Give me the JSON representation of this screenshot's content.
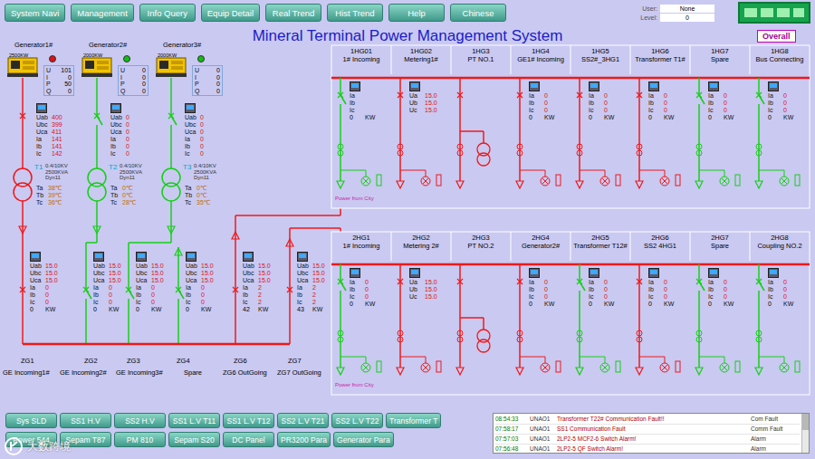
{
  "nav": [
    "System Navi",
    "Management",
    "Info Query",
    "Equip Detail",
    "Real Trend",
    "Hist Trend",
    "Help",
    "Chinese"
  ],
  "user": {
    "user_label": "User:",
    "user": "None",
    "level_label": "Level:",
    "level": "0"
  },
  "title": "Mineral Terminal Power Management System",
  "overall": "Overall",
  "generators": [
    {
      "name": "Generator1#",
      "rating": "2500KW",
      "running": true,
      "status_color": "#e01010",
      "readings": [
        {
          "label": "U",
          "value": "101"
        },
        {
          "label": "I",
          "value": "0"
        },
        {
          "label": "P",
          "value": "50"
        },
        {
          "label": "Q",
          "value": "0"
        }
      ],
      "breaker": {
        "closed": true,
        "readings": [
          {
            "label": "Uab",
            "value": "400"
          },
          {
            "label": "Ubc",
            "value": "399"
          },
          {
            "label": "Uca",
            "value": "411"
          },
          {
            "label": "Ia",
            "value": "141"
          },
          {
            "label": "Ib",
            "value": "141"
          },
          {
            "label": "Ic",
            "value": "142"
          }
        ]
      },
      "transformer": {
        "name": "T1",
        "spec": [
          "0.4/10KV",
          "2500KVA",
          "Dyn11"
        ],
        "temps": [
          {
            "label": "Ta",
            "value": "38℃"
          },
          {
            "label": "Tb",
            "value": "39℃"
          },
          {
            "label": "Tc",
            "value": "36℃"
          }
        ]
      }
    },
    {
      "name": "Generator2#",
      "rating": "2000KW",
      "running": false,
      "status_color": "#10c010",
      "readings": [
        {
          "label": "U",
          "value": "0"
        },
        {
          "label": "I",
          "value": "0"
        },
        {
          "label": "P",
          "value": "0"
        },
        {
          "label": "Q",
          "value": "0"
        }
      ],
      "breaker": {
        "closed": false,
        "readings": [
          {
            "label": "Uab",
            "value": "0"
          },
          {
            "label": "Ubc",
            "value": "0"
          },
          {
            "label": "Uca",
            "value": "0"
          },
          {
            "label": "Ia",
            "value": "0"
          },
          {
            "label": "Ib",
            "value": "0"
          },
          {
            "label": "Ic",
            "value": "0"
          }
        ]
      },
      "transformer": {
        "name": "T2",
        "spec": [
          "0.4/10KV",
          "2500KVA",
          "Dyn11"
        ],
        "temps": [
          {
            "label": "Ta",
            "value": "0℃"
          },
          {
            "label": "Tb",
            "value": "0℃"
          },
          {
            "label": "Tc",
            "value": "28℃"
          }
        ]
      }
    },
    {
      "name": "Generator3#",
      "rating": "2000KW",
      "running": false,
      "status_color": "#10c010",
      "readings": [
        {
          "label": "U",
          "value": "0"
        },
        {
          "label": "I",
          "value": "0"
        },
        {
          "label": "P",
          "value": "0"
        },
        {
          "label": "Q",
          "value": "0"
        }
      ],
      "breaker": {
        "closed": false,
        "readings": [
          {
            "label": "Uab",
            "value": "0"
          },
          {
            "label": "Ubc",
            "value": "0"
          },
          {
            "label": "Uca",
            "value": "0"
          },
          {
            "label": "Ia",
            "value": "0"
          },
          {
            "label": "Ib",
            "value": "0"
          },
          {
            "label": "Ic",
            "value": "0"
          }
        ]
      },
      "transformer": {
        "name": "T3",
        "spec": [
          "0.4/10KV",
          "2500KVA",
          "Dyn11"
        ],
        "temps": [
          {
            "label": "Ta",
            "value": "0℃"
          },
          {
            "label": "Tb",
            "value": "0℃"
          },
          {
            "label": "Tc",
            "value": "35℃"
          }
        ]
      }
    }
  ],
  "zg_feeders": [
    {
      "code": "ZG1",
      "name": "GE Incoming1#",
      "closed": true,
      "readings": [
        {
          "label": "Uab",
          "value": "15.0"
        },
        {
          "label": "Ubc",
          "value": "15.0"
        },
        {
          "label": "Uca",
          "value": "15.0"
        },
        {
          "label": "Ia",
          "value": "0"
        },
        {
          "label": "Ib",
          "value": "0"
        },
        {
          "label": "Ic",
          "value": "0"
        }
      ],
      "power": "0",
      "unit": "KW"
    },
    {
      "code": "ZG2",
      "name": "GE Incoming2#",
      "closed": false,
      "readings": [
        {
          "label": "Uab",
          "value": "15.0"
        },
        {
          "label": "Ubc",
          "value": "15.0"
        },
        {
          "label": "Uca",
          "value": "15.0"
        },
        {
          "label": "Ia",
          "value": "0"
        },
        {
          "label": "Ib",
          "value": "0"
        },
        {
          "label": "Ic",
          "value": "0"
        }
      ],
      "power": "0",
      "unit": "KW"
    },
    {
      "code": "ZG3",
      "name": "GE Incoming3#",
      "closed": false,
      "readings": [
        {
          "label": "Uab",
          "value": "15.0"
        },
        {
          "label": "Ubc",
          "value": "15.0"
        },
        {
          "label": "Uca",
          "value": "15.0"
        },
        {
          "label": "Ia",
          "value": "0"
        },
        {
          "label": "Ib",
          "value": "0"
        },
        {
          "label": "Ic",
          "value": "0"
        }
      ],
      "power": "0",
      "unit": "KW"
    },
    {
      "code": "ZG4",
      "name": "Spare",
      "closed": false,
      "readings": [
        {
          "label": "Uab",
          "value": "15.0"
        },
        {
          "label": "Ubc",
          "value": "15.0"
        },
        {
          "label": "Uca",
          "value": "15.0"
        },
        {
          "label": "Ia",
          "value": "0"
        },
        {
          "label": "Ib",
          "value": "0"
        },
        {
          "label": "Ic",
          "value": "0"
        }
      ],
      "power": "0",
      "unit": "KW"
    },
    {
      "code": "ZG6",
      "name": "ZG6 OutGoing",
      "closed": true,
      "readings": [
        {
          "label": "Uab",
          "value": "15.0"
        },
        {
          "label": "Ubc",
          "value": "15.0"
        },
        {
          "label": "Uca",
          "value": "15.0"
        },
        {
          "label": "Ia",
          "value": "2"
        },
        {
          "label": "Ib",
          "value": "2"
        },
        {
          "label": "Ic",
          "value": "2"
        }
      ],
      "power": "42",
      "unit": "KW"
    },
    {
      "code": "ZG7",
      "name": "ZG7 OutGoing",
      "closed": true,
      "readings": [
        {
          "label": "Uab",
          "value": "15.0"
        },
        {
          "label": "Ubc",
          "value": "15.0"
        },
        {
          "label": "Uca",
          "value": "15.0"
        },
        {
          "label": "Ia",
          "value": "2"
        },
        {
          "label": "Ib",
          "value": "2"
        },
        {
          "label": "Ic",
          "value": "2"
        }
      ],
      "power": "43",
      "unit": "KW"
    }
  ],
  "hg_rows": [
    {
      "city_label": "Power from City",
      "panels": [
        {
          "code": "1HG01",
          "name": "1# Incoming",
          "kind": "feeder",
          "energized": false,
          "readings": [
            {
              "label": "Ia",
              "value": ""
            },
            {
              "label": "Ib",
              "value": ""
            },
            {
              "label": "Ic",
              "value": ""
            }
          ],
          "power": "0",
          "unit": "KW"
        },
        {
          "code": "1HG02",
          "name": "Metering1#",
          "kind": "metering",
          "energized": true,
          "readings": [
            {
              "label": "Ua",
              "value": "15.0"
            },
            {
              "label": "Ub",
              "value": "15.0"
            },
            {
              "label": "Uc",
              "value": "15.0"
            }
          ]
        },
        {
          "code": "1HG3",
          "name": "PT NO.1",
          "kind": "pt",
          "energized": true,
          "readings": []
        },
        {
          "code": "1HG4",
          "name": "GE1# Incoming",
          "kind": "feeder",
          "energized": true,
          "readings": [
            {
              "label": "Ia",
              "value": "0"
            },
            {
              "label": "Ib",
              "value": "0"
            },
            {
              "label": "Ic",
              "value": "0"
            }
          ],
          "power": "0",
          "unit": "KW"
        },
        {
          "code": "1HG5",
          "name": "SS2#_3HG1",
          "kind": "feeder",
          "energized": true,
          "readings": [
            {
              "label": "Ia",
              "value": "0"
            },
            {
              "label": "Ib",
              "value": "0"
            },
            {
              "label": "Ic",
              "value": "0"
            }
          ],
          "power": "0",
          "unit": "KW"
        },
        {
          "code": "1HG6",
          "name": "Transformer T1#",
          "kind": "feeder",
          "energized": true,
          "readings": [
            {
              "label": "Ia",
              "value": "0"
            },
            {
              "label": "Ib",
              "value": "0"
            },
            {
              "label": "Ic",
              "value": "0"
            }
          ],
          "power": "0",
          "unit": "KW"
        },
        {
          "code": "1HG7",
          "name": "Spare",
          "kind": "feeder",
          "energized": false,
          "readings": [
            {
              "label": "Ia",
              "value": "0"
            },
            {
              "label": "Ib",
              "value": "0"
            },
            {
              "label": "Ic",
              "value": "0"
            }
          ],
          "power": "0",
          "unit": "KW"
        },
        {
          "code": "1HG8",
          "name": "Bus Connecting",
          "kind": "feeder",
          "energized": false,
          "readings": [
            {
              "label": "Ia",
              "value": "0"
            },
            {
              "label": "Ib",
              "value": "0"
            },
            {
              "label": "Ic",
              "value": "0"
            }
          ],
          "power": "0",
          "unit": "KW"
        }
      ]
    },
    {
      "city_label": "Power from City",
      "panels": [
        {
          "code": "2HG1",
          "name": "1# Incoming",
          "kind": "feeder",
          "energized": false,
          "readings": [
            {
              "label": "Ia",
              "value": "0"
            },
            {
              "label": "Ib",
              "value": "0"
            },
            {
              "label": "Ic",
              "value": "0"
            }
          ],
          "power": "0",
          "unit": "KW"
        },
        {
          "code": "2HG2",
          "name": "Metering 2#",
          "kind": "metering",
          "energized": true,
          "readings": [
            {
              "label": "Ua",
              "value": "15.0"
            },
            {
              "label": "Ub",
              "value": "15.0"
            },
            {
              "label": "Uc",
              "value": "15.0"
            }
          ]
        },
        {
          "code": "2HG3",
          "name": "PT NO.2",
          "kind": "pt",
          "energized": true,
          "readings": []
        },
        {
          "code": "2HG4",
          "name": "Generator2#",
          "kind": "feeder",
          "energized": true,
          "readings": [
            {
              "label": "Ia",
              "value": "0"
            },
            {
              "label": "Ib",
              "value": "0"
            },
            {
              "label": "Ic",
              "value": "0"
            }
          ],
          "power": "0",
          "unit": "KW"
        },
        {
          "code": "2HG5",
          "name": "Transformer T12#",
          "kind": "feeder",
          "energized": false,
          "readings": [
            {
              "label": "Ia",
              "value": "0"
            },
            {
              "label": "Ib",
              "value": "0"
            },
            {
              "label": "Ic",
              "value": "0"
            }
          ],
          "power": "0",
          "unit": "KW"
        },
        {
          "code": "2HG6",
          "name": "SS2 4HG1",
          "kind": "feeder",
          "energized": true,
          "readings": [
            {
              "label": "Ia",
              "value": "0"
            },
            {
              "label": "Ib",
              "value": "0"
            },
            {
              "label": "Ic",
              "value": "0"
            }
          ],
          "power": "0",
          "unit": "KW"
        },
        {
          "code": "2HG7",
          "name": "Spare",
          "kind": "feeder",
          "energized": false,
          "readings": [
            {
              "label": "Ia",
              "value": "0"
            },
            {
              "label": "Ib",
              "value": "0"
            },
            {
              "label": "Ic",
              "value": "0"
            }
          ],
          "power": "0",
          "unit": "KW"
        },
        {
          "code": "2HG8",
          "name": "Coupling NO.2",
          "kind": "feeder",
          "energized": false,
          "readings": [
            {
              "label": "Ia",
              "value": "0"
            },
            {
              "label": "Ib",
              "value": "0"
            },
            {
              "label": "Ic",
              "value": "0"
            }
          ],
          "power": "0",
          "unit": "KW"
        }
      ]
    }
  ],
  "bottom_buttons": [
    [
      "Sys SLD",
      "SS1 H.V",
      "SS2 H.V",
      "SS1 L.V T11",
      "SS1 L.V T12",
      "SS2 L.V T21",
      "SS2 L.V T22",
      "Transformer T"
    ],
    [
      "Power 544",
      "Sepam T87",
      "PM 810",
      "Sepam S20",
      "DC Panel",
      "PR3200 Para",
      "Generator Para"
    ]
  ],
  "alarms": [
    {
      "time": "08:54:33",
      "site": "UNAO1",
      "message": "Transformer T22# Communication Fault!!",
      "type": "Com Fault"
    },
    {
      "time": "07:58:17",
      "site": "UNAO1",
      "message": "SS1 Communication Fault",
      "type": "Comm Fault"
    },
    {
      "time": "07:57:03",
      "site": "UNAO1",
      "message": "2LP2-5 MCF2-6 Switch Alarm!",
      "type": "Alarm"
    },
    {
      "time": "07:56:48",
      "site": "UNAO1",
      "message": "2LP2-5 QF Switch Alarm!",
      "type": "Alarm"
    }
  ],
  "watermark": "大数跨境"
}
